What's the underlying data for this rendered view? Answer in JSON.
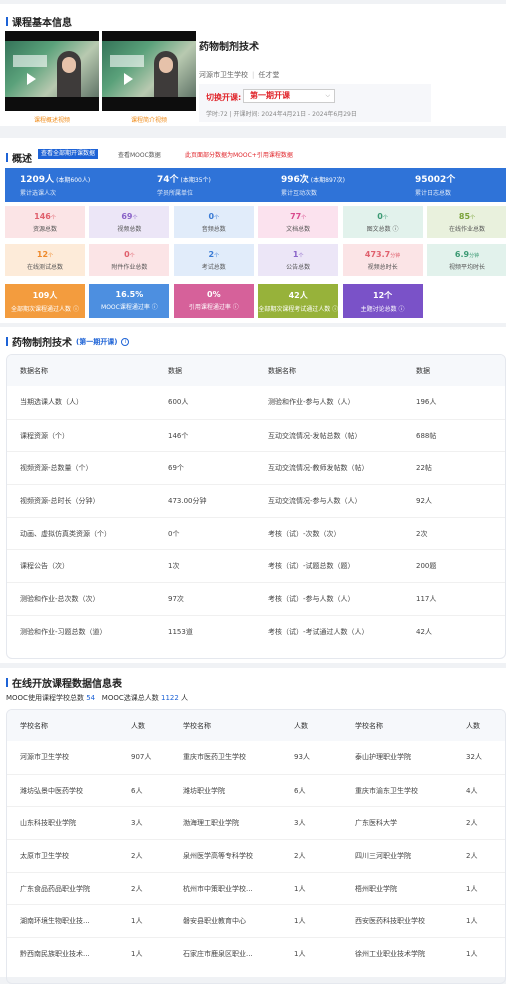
{
  "basic": {
    "title": "课程基本信息",
    "video1_caption": "课程概述视频",
    "video2_caption": "课程简介视频",
    "course_name": "药物制剂技术",
    "school": "河源市卫生学校",
    "teacher": "任才堂",
    "term_label": "切换开课:",
    "term_value": "第一期开课",
    "term_info": "学时:72 | 开课时间: 2024年4月21日 - 2024年6月29日"
  },
  "overview": {
    "title": "概述",
    "tab_active": "查看全部期开课数据",
    "tab_mooc": "查看MOOC数据",
    "warning": "此页面部分数据为MOOC+引用课程数据",
    "stats": [
      {
        "value": "1209人",
        "sub": "(本期600人)",
        "label": "累计选课人次"
      },
      {
        "value": "74个",
        "sub": "(本期35个)",
        "label": "学员所属单位"
      },
      {
        "value": "996次",
        "sub": "(本期897次)",
        "label": "累计互动次数"
      },
      {
        "value": "95002个",
        "sub": "",
        "label": "累计日志总数"
      }
    ],
    "tiles_row1": [
      {
        "value": "146",
        "unit": "个",
        "label": "资源总数",
        "bg": "#fbe4e6",
        "fg": "#e0606d"
      },
      {
        "value": "69",
        "unit": "个",
        "label": "视频总数",
        "bg": "#ece6f7",
        "fg": "#8a63c8"
      },
      {
        "value": "0",
        "unit": "个",
        "label": "音频总数",
        "bg": "#e1ecfa",
        "fg": "#3a7bd5"
      },
      {
        "value": "77",
        "unit": "个",
        "label": "文档总数",
        "bg": "#fbe2ee",
        "fg": "#d94b8e"
      },
      {
        "value": "0",
        "unit": "个",
        "label": "图文总数 ⓘ",
        "bg": "#e2f2ec",
        "fg": "#3c9a74"
      },
      {
        "value": "85",
        "unit": "个",
        "label": "在线作业总数",
        "bg": "#e9f1dd",
        "fg": "#7ba33a"
      }
    ],
    "tiles_row2": [
      {
        "value": "12",
        "unit": "个",
        "label": "在线测试总数",
        "bg": "#fdebd9",
        "fg": "#ee8a2c"
      },
      {
        "value": "0",
        "unit": "个",
        "label": "附件作业总数",
        "bg": "#fbe4e6",
        "fg": "#e0606d"
      },
      {
        "value": "2",
        "unit": "个",
        "label": "考试总数",
        "bg": "#e1ecfa",
        "fg": "#3a7bd5"
      },
      {
        "value": "1",
        "unit": "个",
        "label": "公告总数",
        "bg": "#ece6f7",
        "fg": "#8a63c8"
      },
      {
        "value": "473.7",
        "unit": "分钟",
        "label": "视频总时长",
        "bg": "#fbe4e6",
        "fg": "#e0606d"
      },
      {
        "value": "6.9",
        "unit": "分钟",
        "label": "视频平均时长",
        "bg": "#e2f2ec",
        "fg": "#3c9a74"
      }
    ],
    "tiles_row3": [
      {
        "value": "109人",
        "label": "全部期次课程通过人数 ⓘ",
        "bg": "#f39c3e"
      },
      {
        "value": "16.5%",
        "label": "MOOC课程通过率 ⓘ",
        "bg": "#4d8fe0"
      },
      {
        "value": "0%",
        "label": "引用课程通过率 ⓘ",
        "bg": "#d6619a"
      },
      {
        "value": "42人",
        "label": "全部期次课程考试通过人数 ⓘ",
        "bg": "#97b23a"
      },
      {
        "value": "12个",
        "label": "主题讨论总数 ⓘ",
        "bg": "#7a52c8"
      }
    ]
  },
  "course_stats": {
    "title": "药物制剂技术",
    "term": "(第一期开课)",
    "info_icon": "i",
    "headers": [
      "数据名称",
      "数据",
      "数据名称",
      "数据"
    ],
    "rows": [
      [
        "当期选课人数（人）",
        "600人",
        "测验和作业-参与人数（人）",
        "196人"
      ],
      [
        "课程资源（个）",
        "146个",
        "互动交流情况-发帖总数（帖）",
        "688帖"
      ],
      [
        "视频资源-总数量（个）",
        "69个",
        "互动交流情况-教师发帖数（帖）",
        "22帖"
      ],
      [
        "视频资源-总时长（分钟）",
        "473.00分钟",
        "互动交流情况-参与人数（人）",
        "92人"
      ],
      [
        "动画、虚拟仿真类资源（个）",
        "0个",
        "考核（试）-次数（次）",
        "2次"
      ],
      [
        "课程公告（次）",
        "1次",
        "考核（试）-试题总数（题）",
        "200题"
      ],
      [
        "测验和作业-总次数（次）",
        "97次",
        "考核（试）-参与人数（人）",
        "117人"
      ],
      [
        "测验和作业-习题总数（道）",
        "1153道",
        "考核（试）-考试通过人数（人）",
        "42人"
      ]
    ]
  },
  "mooc": {
    "title": "在线开放课程数据信息表",
    "schools_label": "MOOC使用课程学校总数",
    "schools_count": "54",
    "students_label": "MOOC选课总人数",
    "students_count": "1122",
    "students_unit": "人",
    "headers": [
      "学校名称",
      "人数",
      "学校名称",
      "人数",
      "学校名称",
      "人数"
    ],
    "rows": [
      [
        "河源市卫生学校",
        "907人",
        "重庆市医药卫生学校",
        "93人",
        "泰山护理职业学院",
        "32人"
      ],
      [
        "潍坊弘景中医药学校",
        "6人",
        "潍坊职业学院",
        "6人",
        "重庆市渝东卫生学校",
        "4人"
      ],
      [
        "山东科技职业学院",
        "3人",
        "渤海理工职业学院",
        "3人",
        "广东医科大学",
        "2人"
      ],
      [
        "太原市卫生学校",
        "2人",
        "泉州医学高等专科学校",
        "2人",
        "四川三河职业学院",
        "2人"
      ],
      [
        "广东食品药品职业学院",
        "2人",
        "杭州市中策职业学校...",
        "1人",
        "梧州职业学院",
        "1人"
      ],
      [
        "湖南环境生物职业技...",
        "1人",
        "磐安县职业教育中心",
        "1人",
        "西安医药科技职业学校",
        "1人"
      ],
      [
        "黔西南民族职业技术...",
        "1人",
        "石家庄市鹿泉区职业...",
        "1人",
        "徐州工业职业技术学院",
        "1人"
      ]
    ]
  }
}
